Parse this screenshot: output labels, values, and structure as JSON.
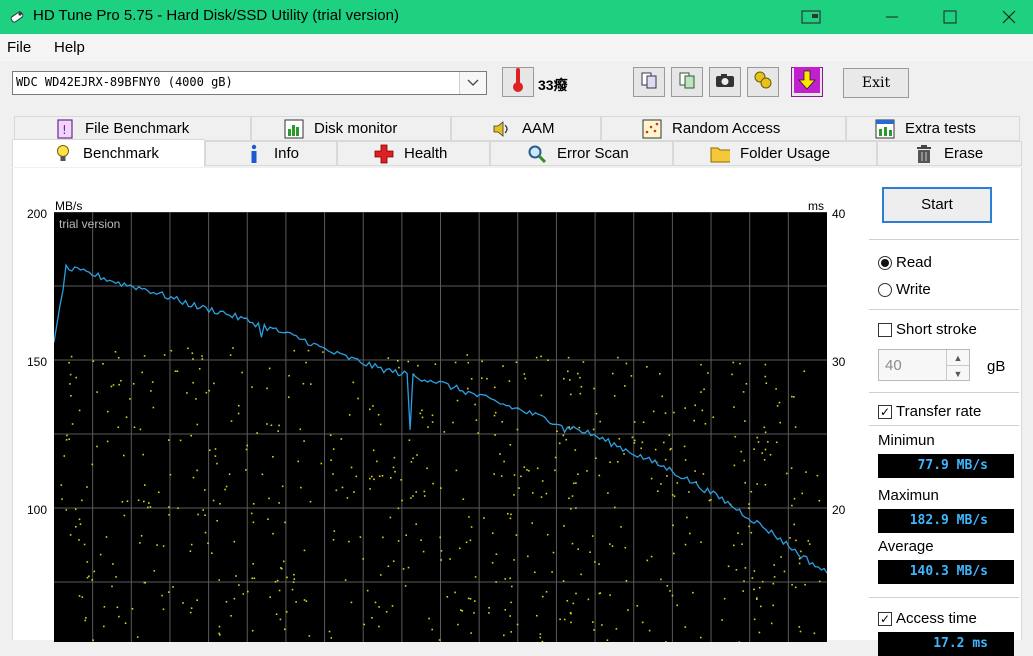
{
  "window": {
    "title": "HD Tune Pro 5.75 - Hard Disk/SSD Utility (trial version)"
  },
  "menu": {
    "file": "File",
    "help": "Help"
  },
  "toolbar": {
    "drive": "WDC WD42EJRX-89BFNY0 (4000 gB)",
    "temperature": "33",
    "temperature_unit": "癈",
    "exit": "Exit"
  },
  "tabs_row1": [
    "File Benchmark",
    "Disk monitor",
    "AAM",
    "Random Access",
    "Extra tests"
  ],
  "tabs_row2": [
    "Benchmark",
    "Info",
    "Health",
    "Error Scan",
    "Folder Usage",
    "Erase"
  ],
  "benchmark": {
    "watermark": "trial version",
    "y_left_unit": "MB/s",
    "y_right_unit": "ms",
    "y_left_ticks": [
      "200",
      "150",
      "100"
    ],
    "y_right_ticks": [
      "40",
      "30",
      "20"
    ]
  },
  "controls": {
    "start": "Start",
    "read": "Read",
    "write": "Write",
    "short_stroke": "Short stroke",
    "short_stroke_value": "40",
    "short_stroke_unit": "gB",
    "transfer_rate": "Transfer rate",
    "minimum_label": "Minimun",
    "minimum_value": "77.9 MB/s",
    "maximum_label": "Maximun",
    "maximum_value": "182.9 MB/s",
    "average_label": "Average",
    "average_value": "140.3 MB/s",
    "access_time": "Access time",
    "access_time_value": "17.2 ms"
  },
  "state": {
    "mode": "read",
    "short_stroke_checked": false,
    "transfer_rate_checked": true,
    "access_time_checked": true
  },
  "chart_data": {
    "type": "line",
    "y_left_range": [
      0,
      200
    ],
    "y_right_range": [
      0,
      40
    ],
    "series": [
      {
        "values": [
          155,
          181,
          179,
          176,
          174,
          171,
          168,
          166,
          163,
          160,
          157,
          153,
          150,
          147,
          145,
          143,
          140,
          137,
          134,
          131,
          128,
          125,
          121,
          117,
          113,
          108,
          103,
          97,
          91,
          84,
          78
        ]
      }
    ],
    "grid": true,
    "access_points_description": "scatter of access-time samples"
  }
}
